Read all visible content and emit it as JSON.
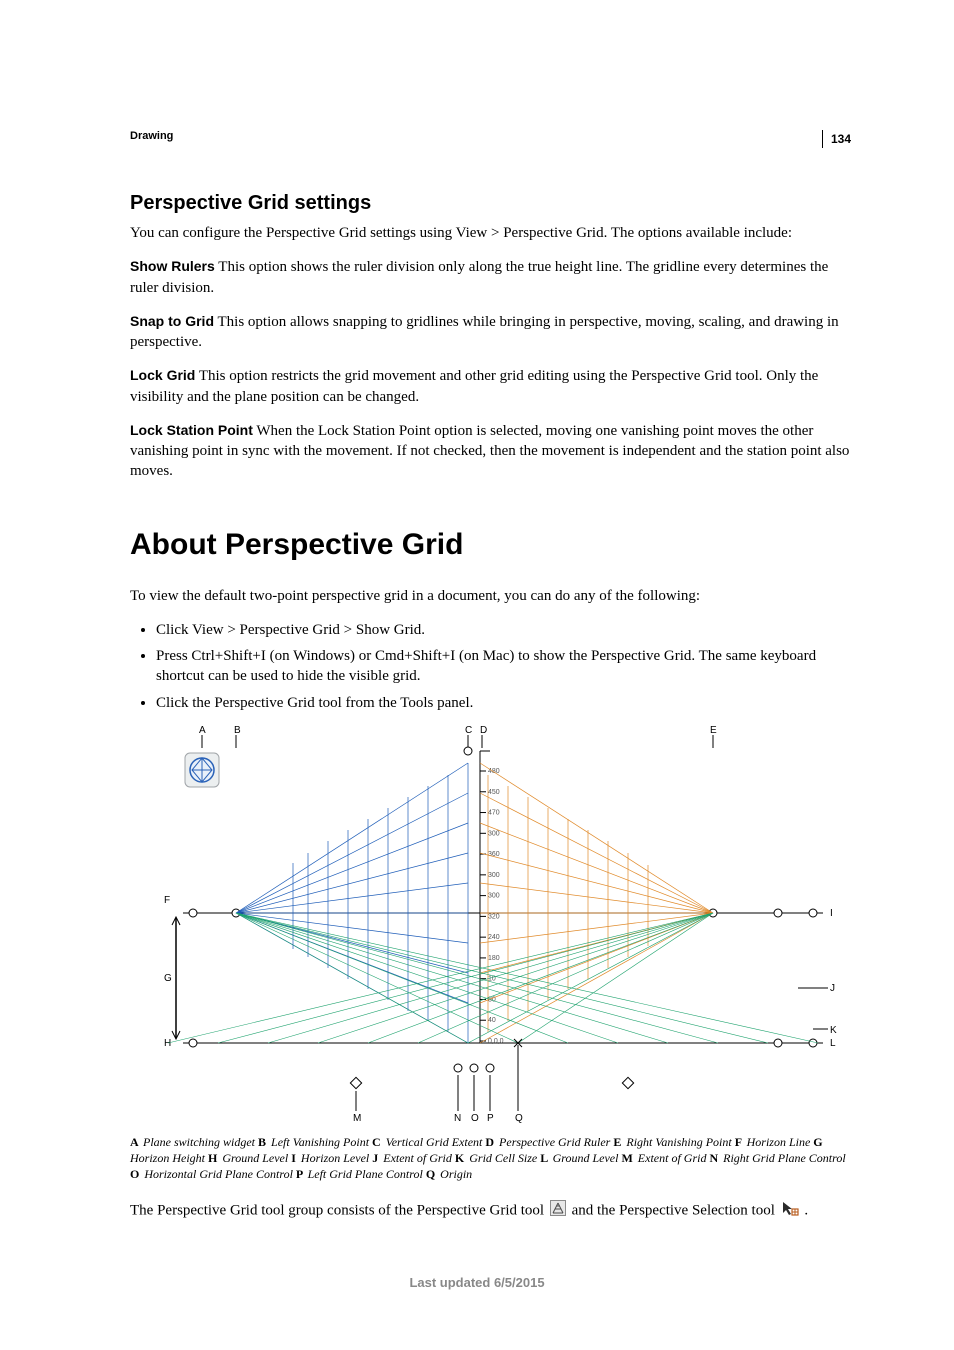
{
  "page_number": "134",
  "breadcrumb": "Drawing",
  "h2": "Perspective Grid settings",
  "intro_p": "You can configure the Perspective Grid settings using View > Perspective Grid. The options available include:",
  "options": {
    "o1_term": "Show Rulers",
    "o1_desc": "This option shows the ruler division only along the true height line. The gridline every determines the ruler division.",
    "o2_term": "Snap to Grid",
    "o2_desc": "This option allows snapping to gridlines while bringing in perspective, moving, scaling, and drawing in perspective.",
    "o3_term": "Lock Grid",
    "o3_desc": "This option restricts the grid movement and other grid editing using the Perspective Grid tool. Only the visibility and the plane position can be changed.",
    "o4_term": "Lock Station Point",
    "o4_desc": "When the Lock Station Point option is selected, moving one vanishing point moves the other vanishing point in sync with the movement. If not checked, then the movement is independent and the station point also moves."
  },
  "h1": "About Perspective Grid",
  "about_p": "To view the default two-point perspective grid in a document, you can do any of the following:",
  "bullets": {
    "b1": "Click View > Perspective Grid > Show Grid.",
    "b2": "Press Ctrl+Shift+I (on Windows) or Cmd+Shift+I (on Mac) to show the Perspective Grid. The same keyboard shortcut can be used to hide the visible grid.",
    "b3": "Click the Perspective Grid tool from the Tools panel."
  },
  "ruler_ticks": [
    "480",
    "450",
    "470",
    "300",
    "360",
    "300",
    "300",
    "320",
    "240",
    "180",
    "10",
    "80",
    "40",
    "0,0,0"
  ],
  "caption_items": {
    "A": "Plane switching widget",
    "B": "Left Vanishing Point",
    "C": "Vertical Grid Extent",
    "D": "Perspective Grid Ruler",
    "E": "Right Vanishing Point",
    "F": "Horizon Line",
    "G": "Horizon Height",
    "H": "Ground Level",
    "I": "Horizon Level",
    "J": "Extent of Grid",
    "K": "Grid Cell Size",
    "L": "Ground Level",
    "M": "Extent of Grid",
    "N": "Right Grid Plane Control",
    "O": "Horizontal Grid Plane Control",
    "P": "Left Grid Plane Control",
    "Q": "Origin"
  },
  "tool_sentence": {
    "part1": "The Perspective Grid tool group consists of the Perspective Grid tool ",
    "part2": " and the Perspective Selection tool ",
    "part3": "."
  },
  "footer": "Last updated 6/5/2015"
}
